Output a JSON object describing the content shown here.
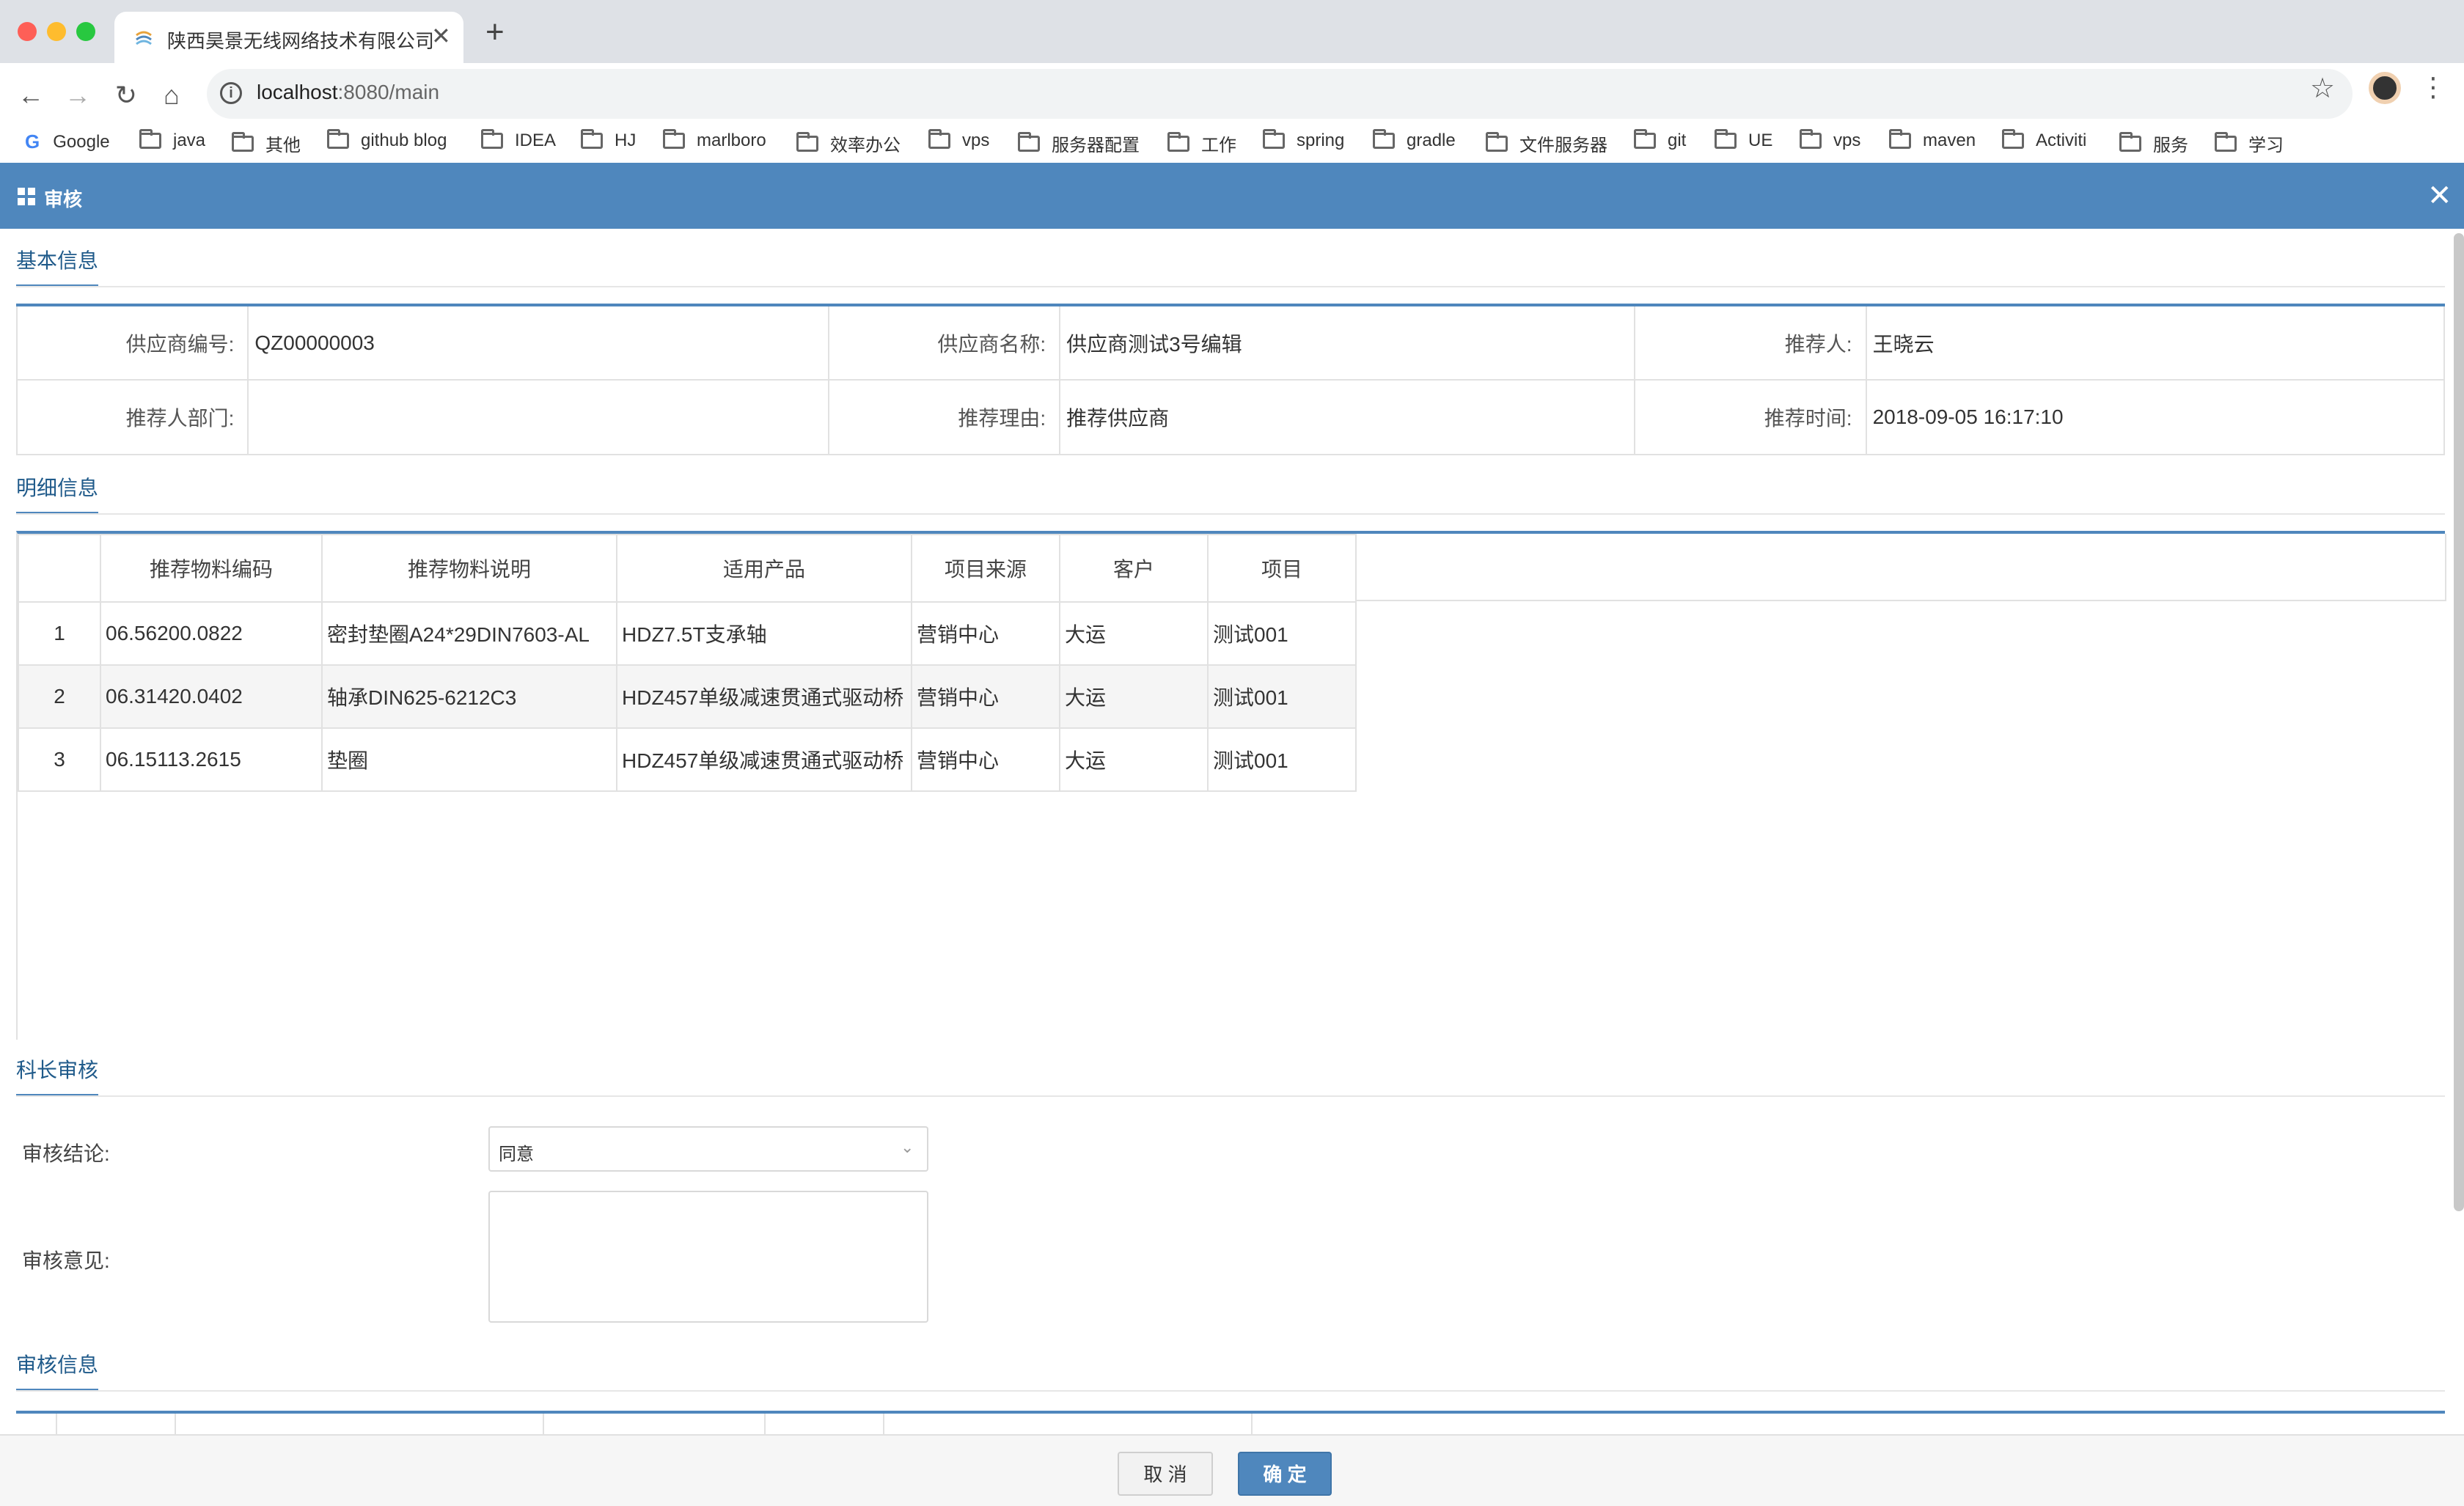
{
  "browser": {
    "tab_title": "陕西昊景无线网络技术有限公司",
    "tab_close": "✕",
    "new_tab": "+",
    "url_host": "localhost",
    "url_rest": ":8080/main",
    "bookmarks": [
      "Google",
      "java",
      "其他",
      "github blog",
      "IDEA",
      "HJ",
      "marlboro",
      "效率办公",
      "vps",
      "服务器配置",
      "工作",
      "spring",
      "gradle",
      "文件服务器",
      "git",
      "UE",
      "vps",
      "maven",
      "Activiti",
      "服务",
      "学习"
    ]
  },
  "dialog": {
    "title": "审核",
    "close": "✕"
  },
  "basic_info": {
    "section_title": "基本信息",
    "supplier_code_label": "供应商编号:",
    "supplier_code": "QZ00000003",
    "supplier_name_label": "供应商名称:",
    "supplier_name": "供应商测试3号编辑",
    "recommender_label": "推荐人:",
    "recommender": "王晓云",
    "dept_label": "推荐人部门:",
    "dept": "",
    "reason_label": "推荐理由:",
    "reason": "推荐供应商",
    "time_label": "推荐时间:",
    "time": "2018-09-05 16:17:10"
  },
  "detail_info": {
    "section_title": "明细信息",
    "columns": [
      "",
      "推荐物料编码",
      "推荐物料说明",
      "适用产品",
      "项目来源",
      "客户",
      "项目"
    ],
    "rows": [
      [
        "1",
        "06.56200.0822",
        "密封垫圈A24*29DIN7603-AL",
        "HDZ7.5T支承轴",
        "营销中心",
        "大运",
        "测试001"
      ],
      [
        "2",
        "06.31420.0402",
        "轴承DIN625-6212C3",
        "HDZ457单级减速贯通式驱动桥",
        "营销中心",
        "大运",
        "测试001"
      ],
      [
        "3",
        "06.15113.2615",
        "垫圈",
        "HDZ457单级减速贯通式驱动桥",
        "营销中心",
        "大运",
        "测试001"
      ]
    ]
  },
  "chief_review": {
    "section_title": "科长审核",
    "conclusion_label": "审核结论:",
    "conclusion_value": "同意",
    "opinion_label": "审核意见:",
    "opinion_value": ""
  },
  "review_info": {
    "section_title": "审核信息"
  },
  "footer": {
    "cancel_label": "取 消",
    "ok_label": "确 定"
  }
}
